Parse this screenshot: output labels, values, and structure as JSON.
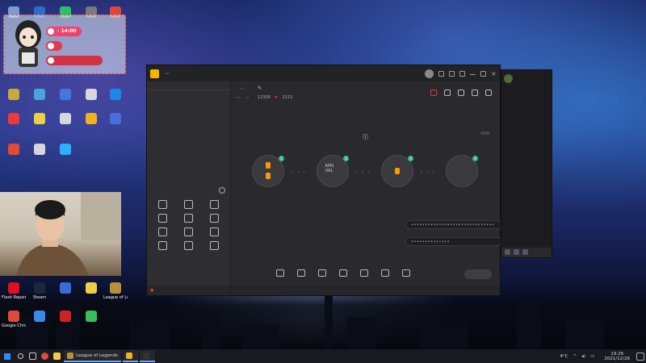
{
  "desktop": {
    "icons": [
      {
        "label": "",
        "color": "#7a9ccf"
      },
      {
        "label": "",
        "color": "#2b6cc4"
      },
      {
        "label": "",
        "color": "#29c26b"
      },
      {
        "label": "",
        "color": "#7a7a7a"
      },
      {
        "label": "",
        "color": "#d84a3c"
      },
      {
        "label": "",
        "color": "#c8a93b"
      },
      {
        "label": "",
        "color": "#4aa3e0"
      },
      {
        "label": "",
        "color": "#4477dd"
      },
      {
        "label": "",
        "color": "#d8d8d8"
      },
      {
        "label": "",
        "color": "#1c87e6"
      },
      {
        "label": "",
        "color": "#ef3838"
      },
      {
        "label": "",
        "color": "#e8d144"
      },
      {
        "label": "",
        "color": "#d8d8d8"
      },
      {
        "label": "",
        "color": "#f2b01e"
      },
      {
        "label": "",
        "color": "#4a6fd8"
      },
      {
        "label": "",
        "color": "#e34a2f"
      },
      {
        "label": "",
        "color": "#d6d6d6"
      },
      {
        "label": "",
        "color": "#2ab0ff"
      },
      {
        "label": "Flash Repair",
        "color": "#d12"
      },
      {
        "label": "Steam",
        "color": "#1b2838"
      },
      {
        "label": "",
        "color": "#3a6bd8"
      },
      {
        "label": "",
        "color": "#e8d144"
      },
      {
        "label": "League of Legends",
        "color": "#b58f3a"
      },
      {
        "label": "Google Chrome",
        "color": "#dd4b39"
      },
      {
        "label": "",
        "color": "#3a8ae8"
      },
      {
        "label": "",
        "color": "#c22"
      },
      {
        "label": "",
        "color": "#3bbd5a"
      }
    ]
  },
  "overlay": {
    "timer_label": "",
    "timer_value": "14:00",
    "pill2": "",
    "pill3": ""
  },
  "window": {
    "app_title": "",
    "version_badge": "",
    "left_tabs": [
      "",
      "",
      ""
    ],
    "empty_hint": "",
    "tools_title": "",
    "tools": [
      {
        "label": ""
      },
      {
        "label": ""
      },
      {
        "label": ""
      },
      {
        "label": ""
      },
      {
        "label": ""
      },
      {
        "label": ""
      },
      {
        "label": ""
      },
      {
        "label": ""
      },
      {
        "label": ""
      },
      {
        "label": ""
      },
      {
        "label": ""
      },
      {
        "label": ""
      }
    ],
    "left_status": "",
    "room_title": "",
    "room_chip": "",
    "room_cat": "",
    "meta_chip1": "",
    "meta_chip2": "",
    "meta_text1": "",
    "meta_num": "12306",
    "meta_num2": "3213",
    "obs_title": "",
    "exit_label": "",
    "steps": [
      {
        "num": "1",
        "inner": [
          "",
          ""
        ],
        "desc": ""
      },
      {
        "num": "2",
        "inner": [
          "RMS URL",
          ""
        ],
        "desc": ""
      },
      {
        "num": "3",
        "inner": [
          ""
        ],
        "desc": ""
      },
      {
        "num": "4",
        "inner": [
          ""
        ],
        "desc": ""
      }
    ],
    "rtmp_label": "",
    "rtmp_value": "••••••••••••••••••••••••••••••",
    "key_label": "",
    "key_value": "••••••••••••••",
    "copy_label": "",
    "hint": "",
    "bottom_items": [
      {
        "label": ""
      },
      {
        "label": ""
      },
      {
        "label": ""
      },
      {
        "label": ""
      },
      {
        "label": ""
      },
      {
        "label": ""
      },
      {
        "label": ""
      }
    ],
    "start_label": "",
    "status": [
      "",
      "",
      "",
      "",
      "",
      "",
      "",
      ""
    ]
  },
  "chat": {
    "name": "",
    "sub": "",
    "lines": [
      "",
      "",
      "",
      "",
      "",
      ""
    ]
  },
  "taskbar": {
    "apps": [
      {
        "label": "League of Legends",
        "color": "#b58f3a"
      },
      {
        "label": "",
        "color": "#f2b01e"
      },
      {
        "label": "",
        "color": "#333"
      }
    ],
    "weather": "4°C",
    "lang": "",
    "time": "19:26",
    "date": "2021/12/26"
  }
}
